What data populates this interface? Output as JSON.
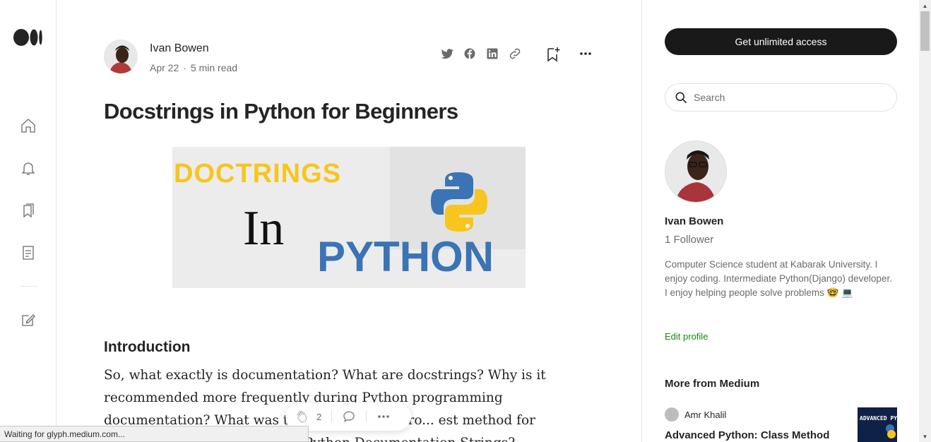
{
  "nav": {
    "logo_icon": "medium-logo-icon",
    "items": [
      {
        "icon": "home-icon"
      },
      {
        "icon": "bell-icon"
      },
      {
        "icon": "bookmarks-icon"
      },
      {
        "icon": "stories-icon"
      },
      {
        "icon": "write-icon"
      }
    ]
  },
  "article": {
    "author": "Ivan Bowen",
    "date": "Apr 22",
    "read_time": "5 min read",
    "title": "Docstrings in Python for Beginners",
    "hero": {
      "line1": "DOCTRINGS",
      "line2": "In",
      "line3": "PYTHON"
    },
    "section_heading": "Introduction",
    "body": "So, what exactly is documentation? What are docstrings? Why is it recommended more frequently during Python programming documentation? What was the source of the pro... est method for documenting ... ormine about Python Documentation Strings?"
  },
  "float_bar": {
    "claps": "2"
  },
  "sidebar": {
    "cta": "Get unlimited access",
    "search_placeholder": "Search",
    "name": "Ivan Bowen",
    "followers": "1 Follower",
    "bio": "Computer Science student at Kabarak University. I enjoy coding. Intermediate Python(Django) developer. I enjoy helping people solve problems 🤓 💻",
    "edit_profile": "Edit profile",
    "more_heading": "More from Medium",
    "rec_author": "Amr Khalil",
    "rec_title": "Advanced Python: Class Method",
    "rec_thumb_text": "ADVANCED PYTHON"
  },
  "status_bar": "Waiting for glyph.medium.com...",
  "colors": {
    "accent_green": "#1a8917",
    "cta_bg": "#191919",
    "hero_yellow": "#f7c51e",
    "hero_blue": "#3a74b5"
  }
}
